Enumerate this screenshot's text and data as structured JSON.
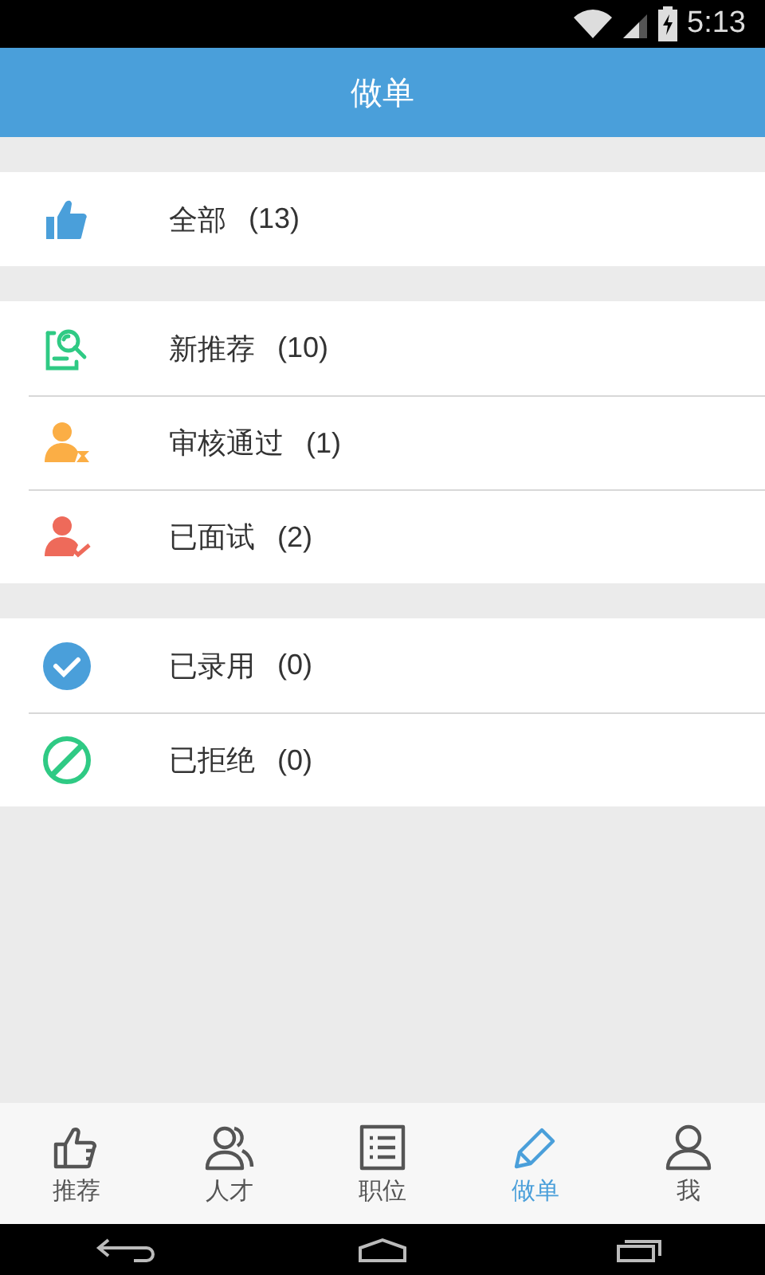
{
  "status_bar": {
    "time": "5:13"
  },
  "header": {
    "title": "做单"
  },
  "groups": [
    {
      "items": [
        {
          "kind": "all",
          "label": "全部",
          "count": "(13)"
        }
      ]
    },
    {
      "items": [
        {
          "kind": "new",
          "label": "新推荐",
          "count": "(10)"
        },
        {
          "kind": "approved",
          "label": "审核通过",
          "count": "(1)"
        },
        {
          "kind": "interviewed",
          "label": "已面试",
          "count": "(2)"
        }
      ]
    },
    {
      "items": [
        {
          "kind": "hired",
          "label": "已录用",
          "count": "(0)"
        },
        {
          "kind": "rejected",
          "label": "已拒绝",
          "count": "(0)"
        }
      ]
    }
  ],
  "tabs": [
    {
      "kind": "thumb",
      "label": "推荐",
      "selected": false
    },
    {
      "kind": "people",
      "label": "人才",
      "selected": false
    },
    {
      "kind": "list",
      "label": "职位",
      "selected": false
    },
    {
      "kind": "pencil",
      "label": "做单",
      "selected": true
    },
    {
      "kind": "person",
      "label": "我",
      "selected": false
    }
  ]
}
